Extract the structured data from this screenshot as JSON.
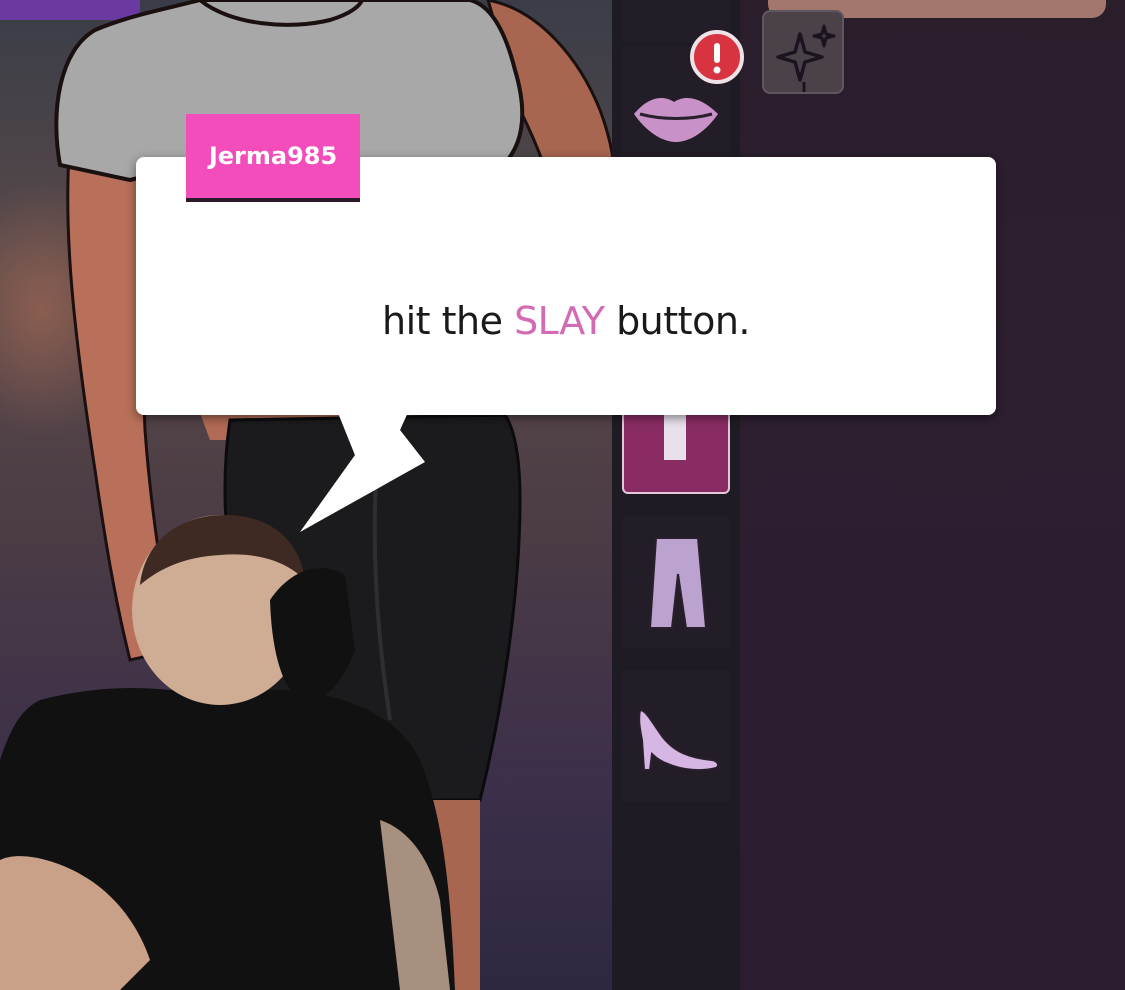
{
  "dialog": {
    "speaker": "Jerma985",
    "text_before": "hit the ",
    "keyword": "SLAY",
    "text_after": " button."
  },
  "colors": {
    "name_tag": "#f24dbb",
    "keyword": "#d26bb4",
    "dialog_bg": "#ffffff",
    "alert": "#d83340"
  },
  "side_panel": {
    "items": [
      {
        "icon": "lips-icon",
        "alert": true
      },
      {
        "icon": "top-icon",
        "selected": true
      },
      {
        "icon": "pants-icon"
      },
      {
        "icon": "high-heel-icon"
      }
    ]
  },
  "top_right": {
    "icon": "sparkle-icon"
  }
}
